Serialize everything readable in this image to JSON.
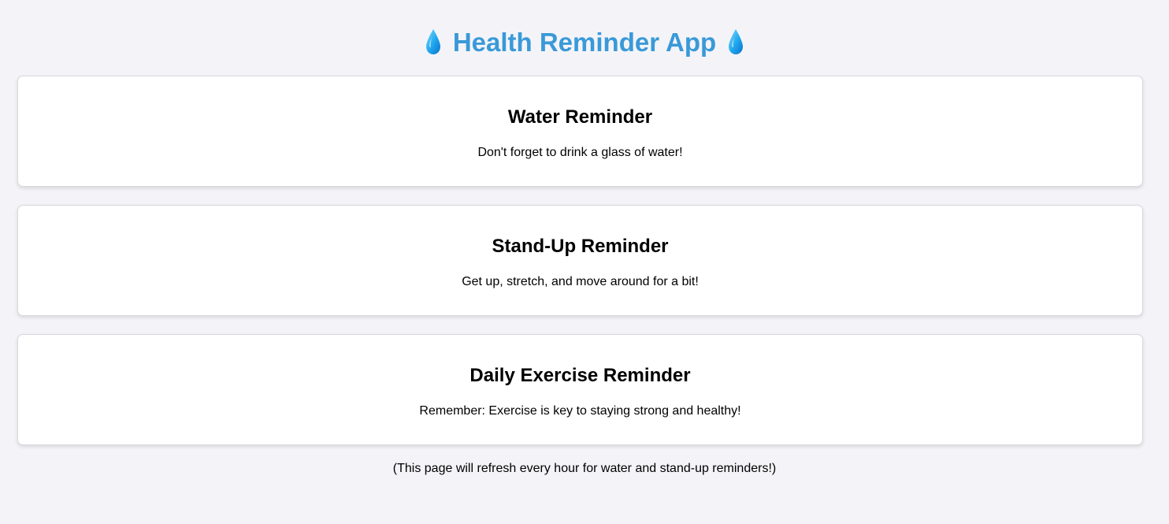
{
  "header": {
    "title": "Health Reminder App",
    "left_icon": "water-drop-icon",
    "right_icon": "water-drop-icon",
    "title_color": "#3a99d8",
    "icon_color": "#2fa9ee"
  },
  "reminders": [
    {
      "title": "Water Reminder",
      "text": "Don't forget to drink a glass of water!"
    },
    {
      "title": "Stand-Up Reminder",
      "text": "Get up, stretch, and move around for a bit!"
    },
    {
      "title": "Daily Exercise Reminder",
      "text": "Remember: Exercise is key to staying strong and healthy!"
    }
  ],
  "footer": {
    "note": "(This page will refresh every hour for water and stand-up reminders!)"
  },
  "colors": {
    "background": "#f4f4f8",
    "card_background": "#ffffff",
    "card_border": "#d8d8de"
  }
}
